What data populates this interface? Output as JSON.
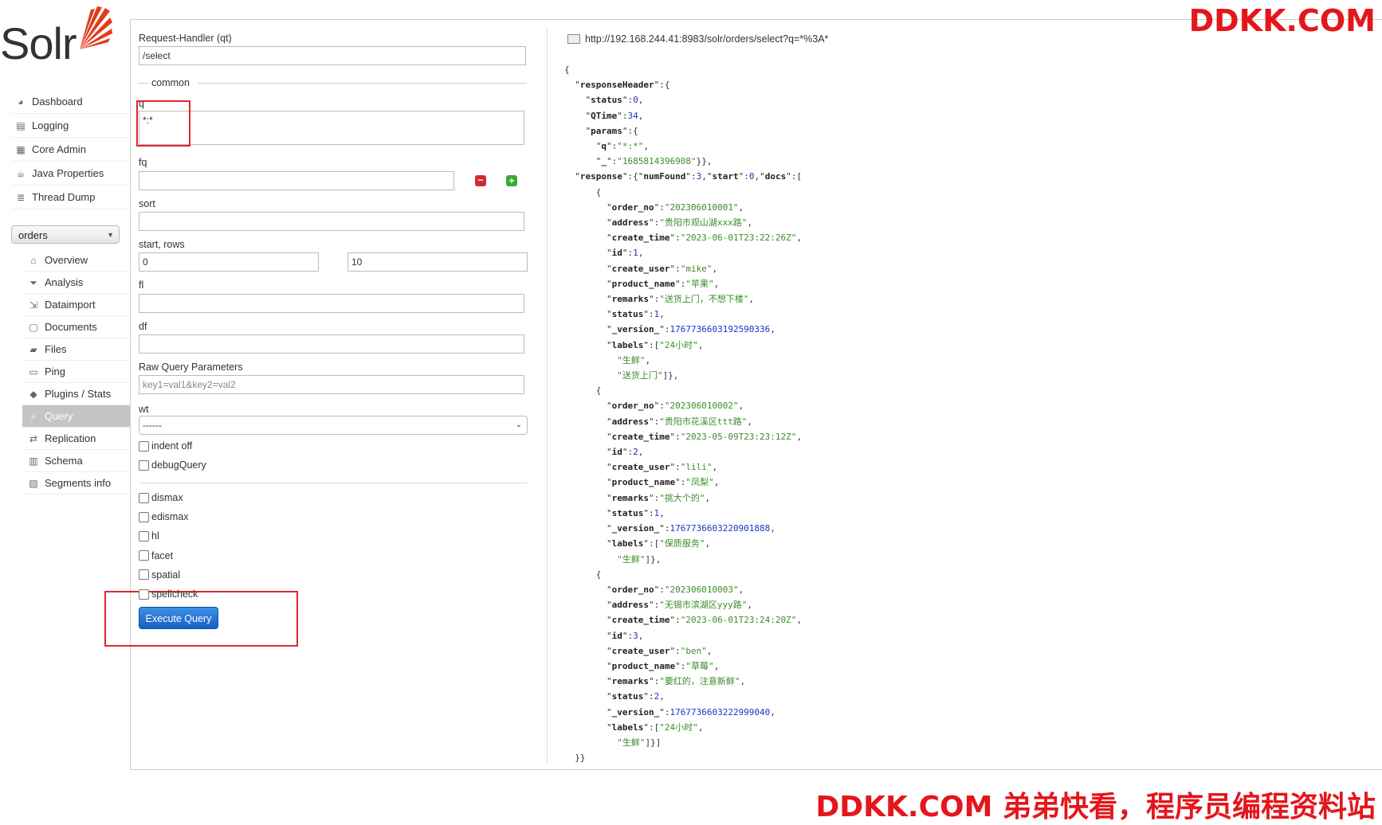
{
  "watermark_top": "DDKK.COM",
  "watermark_bottom": "DDKK.COM 弟弟快看，程序员编程资料站",
  "logo_text": "Solr",
  "sidebar": {
    "items": [
      {
        "label": "Dashboard",
        "icon": "dashboard-icon"
      },
      {
        "label": "Logging",
        "icon": "logging-icon"
      },
      {
        "label": "Core Admin",
        "icon": "core-admin-icon"
      },
      {
        "label": "Java Properties",
        "icon": "java-icon"
      },
      {
        "label": "Thread Dump",
        "icon": "thread-dump-icon"
      }
    ],
    "core_selector": "orders",
    "core_items": [
      {
        "label": "Overview",
        "icon": "home-icon"
      },
      {
        "label": "Analysis",
        "icon": "funnel-icon"
      },
      {
        "label": "Dataimport",
        "icon": "dataimport-icon"
      },
      {
        "label": "Documents",
        "icon": "documents-icon"
      },
      {
        "label": "Files",
        "icon": "folder-icon"
      },
      {
        "label": "Ping",
        "icon": "ping-icon"
      },
      {
        "label": "Plugins / Stats",
        "icon": "plugins-icon"
      },
      {
        "label": "Query",
        "icon": "magnifier-icon",
        "active": true
      },
      {
        "label": "Replication",
        "icon": "replication-icon"
      },
      {
        "label": "Schema",
        "icon": "schema-icon"
      },
      {
        "label": "Segments info",
        "icon": "segments-icon"
      }
    ]
  },
  "form": {
    "request_handler_label": "Request-Handler (qt)",
    "request_handler_value": "/select",
    "common_label": "common",
    "q_label": "q",
    "q_value": "*:*",
    "fq_label": "fq",
    "fq_value": "",
    "sort_label": "sort",
    "sort_value": "",
    "start_rows_label": "start, rows",
    "start_value": "0",
    "rows_value": "10",
    "fl_label": "fl",
    "df_label": "df",
    "raw_label": "Raw Query Parameters",
    "raw_placeholder": "key1=val1&key2=val2",
    "wt_label": "wt",
    "wt_value": "------",
    "checkboxes_a": [
      "indent off",
      "debugQuery"
    ],
    "checkboxes_b": [
      "dismax",
      "edismax",
      "hl",
      "facet",
      "spatial",
      "spellcheck"
    ],
    "execute_label": "Execute Query"
  },
  "result": {
    "url": "http://192.168.244.41:8983/solr/orders/select?q=*%3A*",
    "numFound": 3,
    "start": 0,
    "status": 0,
    "QTime": 34,
    "params": {
      "q": "*:*",
      "_": "1685814396908"
    },
    "docs": [
      {
        "order_no": "202306010001",
        "address": "贵阳市观山湖xxx路",
        "create_time": "2023-06-01T23:22:26Z",
        "id": 1,
        "create_user": "mike",
        "product_name": "苹果",
        "remarks": "送货上门，不想下楼",
        "status": 1,
        "_version_": "1767736603192590336",
        "labels": [
          "24小时",
          "生鲜",
          "送货上门"
        ]
      },
      {
        "order_no": "202306010002",
        "address": "贵阳市花溪区ttt路",
        "create_time": "2023-05-09T23:23:12Z",
        "id": 2,
        "create_user": "lili",
        "product_name": "凤梨",
        "remarks": "挑大个的",
        "status": 1,
        "_version_": "1767736603220901888",
        "labels": [
          "保质服务",
          "生鲜"
        ]
      },
      {
        "order_no": "202306010003",
        "address": "无锡市滨湖区yyy路",
        "create_time": "2023-06-01T23:24:20Z",
        "id": 3,
        "create_user": "ben",
        "product_name": "草莓",
        "remarks": "要红的，注意新鲜",
        "status": 2,
        "_version_": "1767736603222999040",
        "labels": [
          "24小时",
          "生鲜"
        ]
      }
    ]
  },
  "colors": {
    "accent_red": "#e4161c",
    "button_blue": "#1e6fd6",
    "string_green": "#3a8d2a",
    "number_blue": "#2230c9"
  }
}
